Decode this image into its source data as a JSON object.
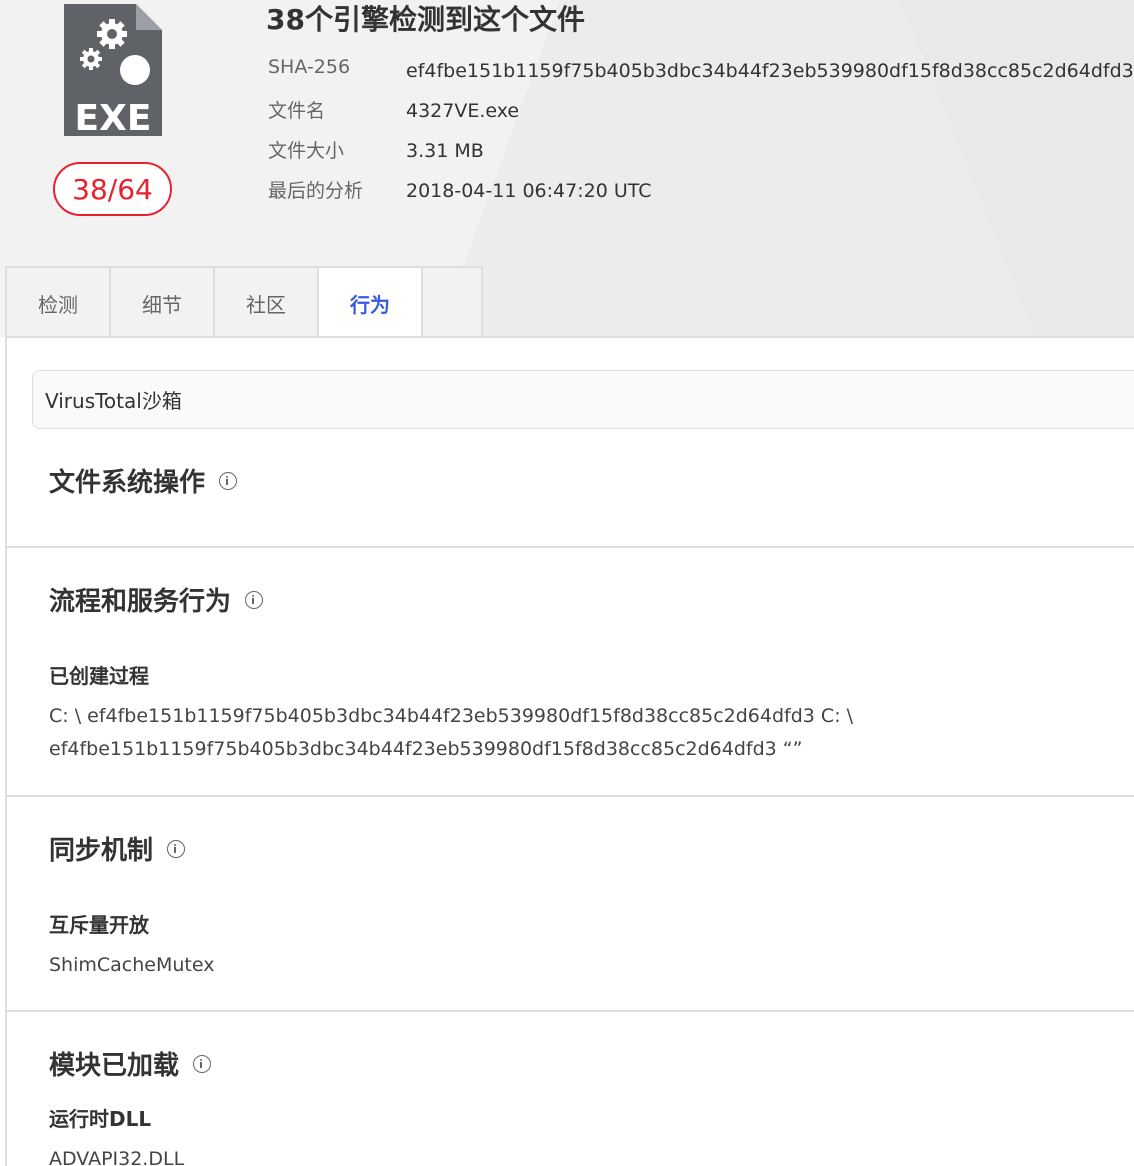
{
  "file": {
    "title": "38个引擎检测到这个文件",
    "icon_label": "EXE",
    "score": "38/64",
    "meta": [
      {
        "label": "SHA-256",
        "value": "ef4fbe151b1159f75b405b3dbc34b44f23eb539980df15f8d38cc85c2d64dfd3"
      },
      {
        "label": "文件名",
        "value": "4327VE.exe"
      },
      {
        "label": "文件大小",
        "value": "3.31 MB"
      },
      {
        "label": "最后的分析",
        "value": "2018-04-11 06:47:20 UTC"
      }
    ]
  },
  "tabs": [
    {
      "label": "检测"
    },
    {
      "label": "细节"
    },
    {
      "label": "社区"
    },
    {
      "label": "行为"
    }
  ],
  "sandbox": {
    "label": "VirusTotal沙箱"
  },
  "sections": {
    "file_system": {
      "title": "文件系统操作"
    },
    "process": {
      "title": "流程和服务行为",
      "sub_title": "已创建过程",
      "lines": [
        "C: \\ ef4fbe151b1159f75b405b3dbc34b44f23eb539980df15f8d38cc85c2d64dfd3 C: \\",
        "ef4fbe151b1159f75b405b3dbc34b44f23eb539980df15f8d38cc85c2d64dfd3 “”"
      ]
    },
    "sync": {
      "title": "同步机制",
      "sub_title": "互斥量开放",
      "value": "ShimCacheMutex"
    },
    "modules": {
      "title": "模块已加载",
      "sub_title": "运行时DLL",
      "value": "ADVAPI32.DLL"
    }
  },
  "colors": {
    "accent": "#3b5bdb",
    "danger": "#e8212e",
    "icon": "#5f6368"
  }
}
